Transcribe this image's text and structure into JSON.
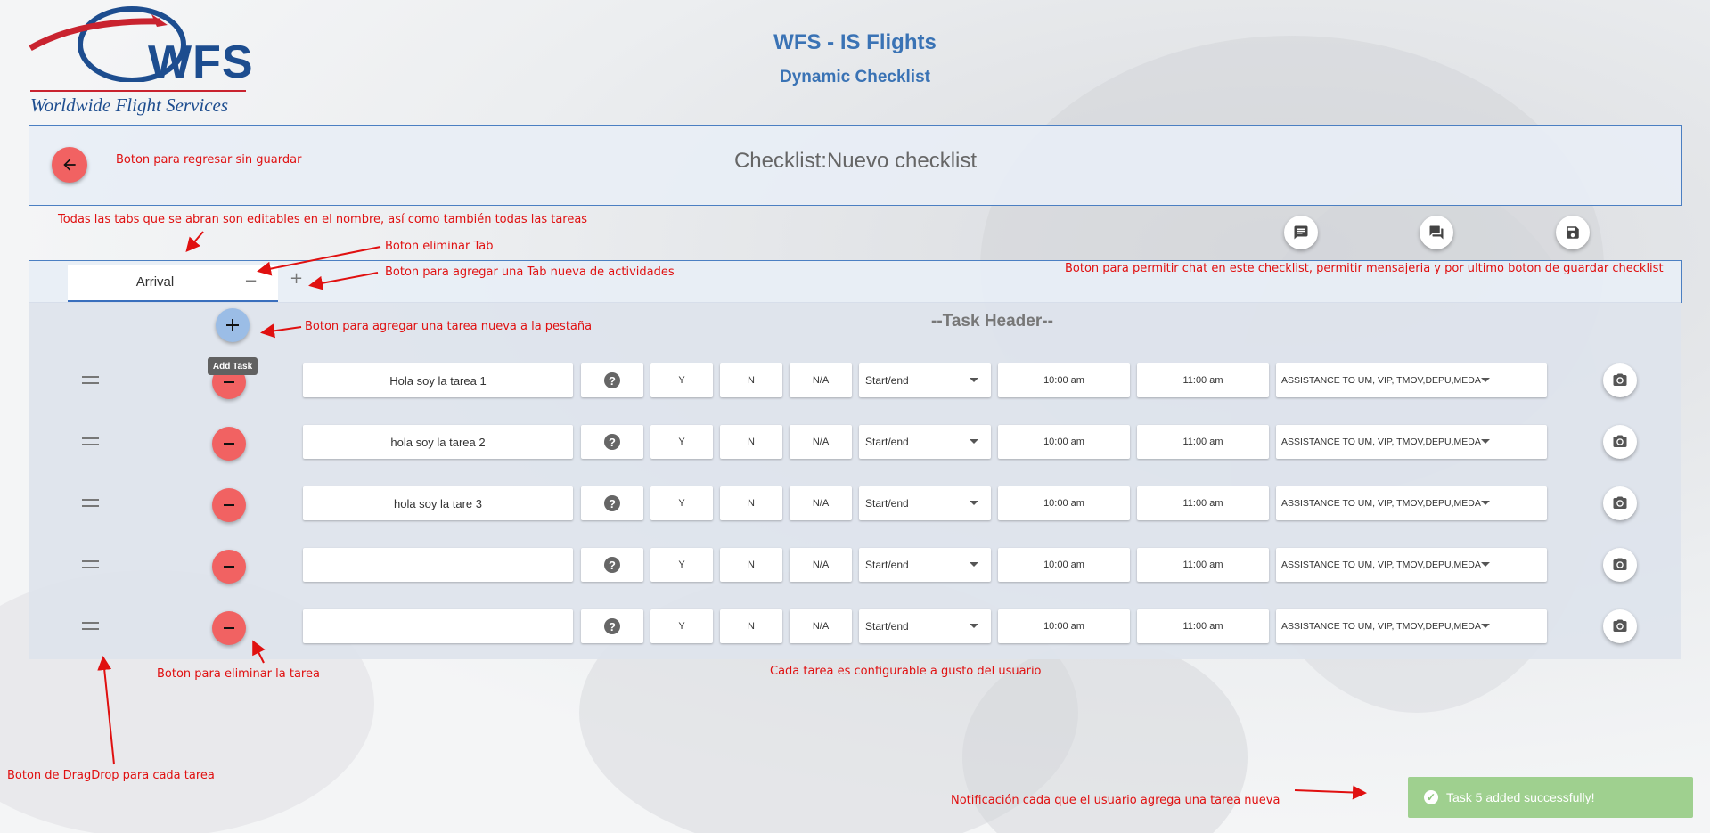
{
  "app": {
    "logo_text": "WFS",
    "logo_subtitle": "Worldwide Flight Services",
    "title": "WFS - IS Flights",
    "subtitle": "Dynamic Checklist"
  },
  "header": {
    "checklist_title": "Checklist:Nuevo checklist"
  },
  "tabs": [
    {
      "label": "Arrival",
      "remove_symbol": "−"
    }
  ],
  "tab_add_symbol": "+",
  "tasks_panel": {
    "add_tooltip": "Add Task",
    "task_header": "--Task Header--"
  },
  "tasks": [
    {
      "name": "Hola soy la tarea 1",
      "y": "Y",
      "n": "N",
      "na": "N/A",
      "type": "Start/end",
      "start_time": "10:00 am",
      "end_time": "11:00 am",
      "assistance": "ASSISTANCE TO UM, VIP, TMOV,DEPU,MEDA"
    },
    {
      "name": "hola soy la tarea 2",
      "y": "Y",
      "n": "N",
      "na": "N/A",
      "type": "Start/end",
      "start_time": "10:00 am",
      "end_time": "11:00 am",
      "assistance": "ASSISTANCE TO UM, VIP, TMOV,DEPU,MEDA"
    },
    {
      "name": "hola soy la tare 3",
      "y": "Y",
      "n": "N",
      "na": "N/A",
      "type": "Start/end",
      "start_time": "10:00 am",
      "end_time": "11:00 am",
      "assistance": "ASSISTANCE TO UM, VIP, TMOV,DEPU,MEDA"
    },
    {
      "name": "",
      "y": "Y",
      "n": "N",
      "na": "N/A",
      "type": "Start/end",
      "start_time": "10:00 am",
      "end_time": "11:00 am",
      "assistance": "ASSISTANCE TO UM, VIP, TMOV,DEPU,MEDA"
    },
    {
      "name": "",
      "y": "Y",
      "n": "N",
      "na": "N/A",
      "type": "Start/end",
      "start_time": "10:00 am",
      "end_time": "11:00 am",
      "assistance": "ASSISTANCE TO UM, VIP, TMOV,DEPU,MEDA"
    }
  ],
  "annotations": {
    "back": "Boton para regresar sin guardar",
    "tabs_editable": "Todas las tabs que se abran son editables en el nombre, así como también todas las tareas",
    "remove_tab": "Boton eliminar Tab",
    "add_tab": "Boton para agregar una Tab nueva de actividades",
    "actions": "Boton para permitir chat en este checklist, permitir mensajeria y por ultimo boton de guardar checklist",
    "add_task": "Boton para agregar una tarea nueva a la pestaña",
    "delete_task": "Boton para eliminar la tarea",
    "configurable": "Cada tarea es configurable a gusto del usuario",
    "dragdrop": "Boton de DragDrop para cada tarea",
    "notification": "Notificación cada que el usuario agrega una tarea nueva"
  },
  "toast": {
    "message": "Task 5 added successfully!"
  },
  "colors": {
    "primary_blue": "#3a73b5",
    "danger_red": "#f16262",
    "annotation_red": "#e01010",
    "toast_green": "#9fd08f"
  }
}
